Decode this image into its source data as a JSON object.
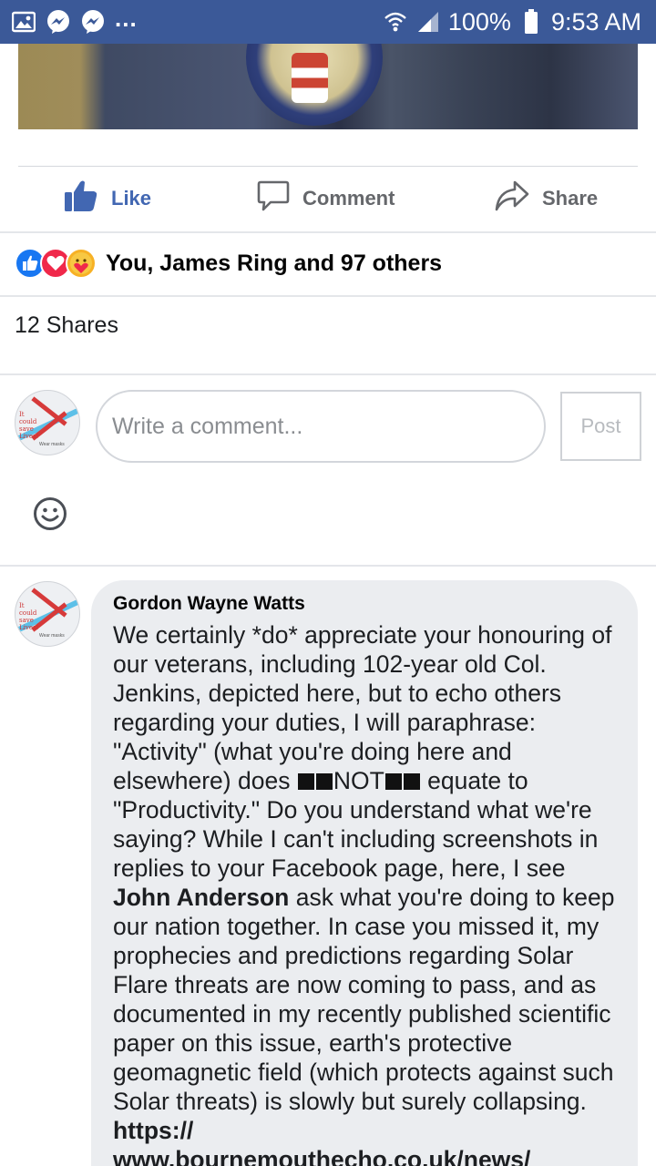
{
  "status_bar": {
    "battery": "100%",
    "time": "9:53 AM",
    "overflow": "..."
  },
  "colors": {
    "status_bar": "#3b5998",
    "fb_blue": "#4267b2",
    "bubble": "#ebedf0"
  },
  "post_actions": {
    "like_label": "Like",
    "comment_label": "Comment",
    "share_label": "Share"
  },
  "reactions": {
    "icons": [
      "like-reaction-icon",
      "love-reaction-icon",
      "care-reaction-icon"
    ],
    "summary": "You, James Ring and 97 others"
  },
  "shares_text": "12 Shares",
  "comment_composer": {
    "placeholder": "Write a comment...",
    "post_label": "Post"
  },
  "avatar_text": {
    "line1": "It",
    "line2": "could",
    "line3": "save",
    "line4": "Lives!",
    "foot": "Wear masks"
  },
  "comment": {
    "author": "Gordon Wayne Watts",
    "text_part1": "We certainly *do* appreciate your honouring of our veterans, including 102-year old Col. Jenkins, depicted here, but to echo others regarding your duties, I will paraphrase: \"Activity\" (what you're doing here and elsewhere) does ",
    "not_word": "NOT",
    "text_part2": " equate to \"Productivity.\" Do you understand what we're saying? While I can't including screenshots in replies to your Facebook page, here, I see ",
    "mention": "John Anderson",
    "text_part3": " ask what you're doing to keep our nation together. In case you missed it, my prophecies and predictions regarding Solar Flare threats are now coming to pass, and as documented in my recently published scientific paper on this issue, earth's protective geomagnetic field (which protects against such Solar threats) is slowly but surely collapsing. ",
    "link": "https:// www.bournemouthecho.co.uk/news/"
  }
}
